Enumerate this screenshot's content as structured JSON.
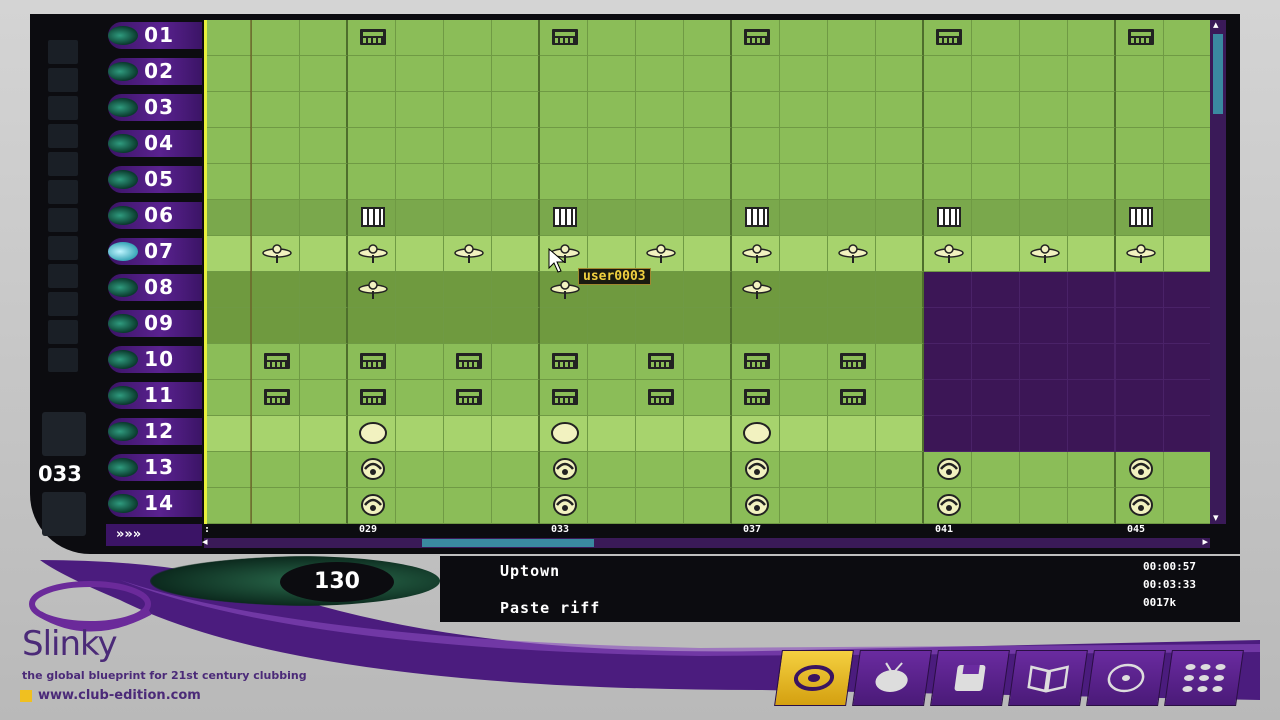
{
  "tracks": [
    "01",
    "02",
    "03",
    "04",
    "05",
    "06",
    "07",
    "08",
    "09",
    "10",
    "11",
    "12",
    "13",
    "14"
  ],
  "active_track": "07",
  "counter": "033",
  "scroll_arrows": "»»»",
  "timeline_ticks": [
    "029",
    "033",
    "037",
    "041",
    "045"
  ],
  "tooltip": "user0003",
  "bpm": "130",
  "song_name": "Uptown",
  "last_action": "Paste riff",
  "time_elapsed": "00:00:57",
  "time_total": "00:03:33",
  "file_size": "0017k",
  "brand": {
    "name": "Slinky",
    "tagline": "the global blueprint for 21st century clubbing",
    "url": "www.club-edition.com"
  },
  "toolbar_icons": [
    "turntable-icon",
    "tv-icon",
    "disk-icon",
    "book-icon",
    "cd-icon",
    "grid-icon"
  ],
  "colors": {
    "accent": "#5a2290",
    "grid": "#8bbd58",
    "playhead": "#e8f03c",
    "highlight": "#f0c020"
  }
}
